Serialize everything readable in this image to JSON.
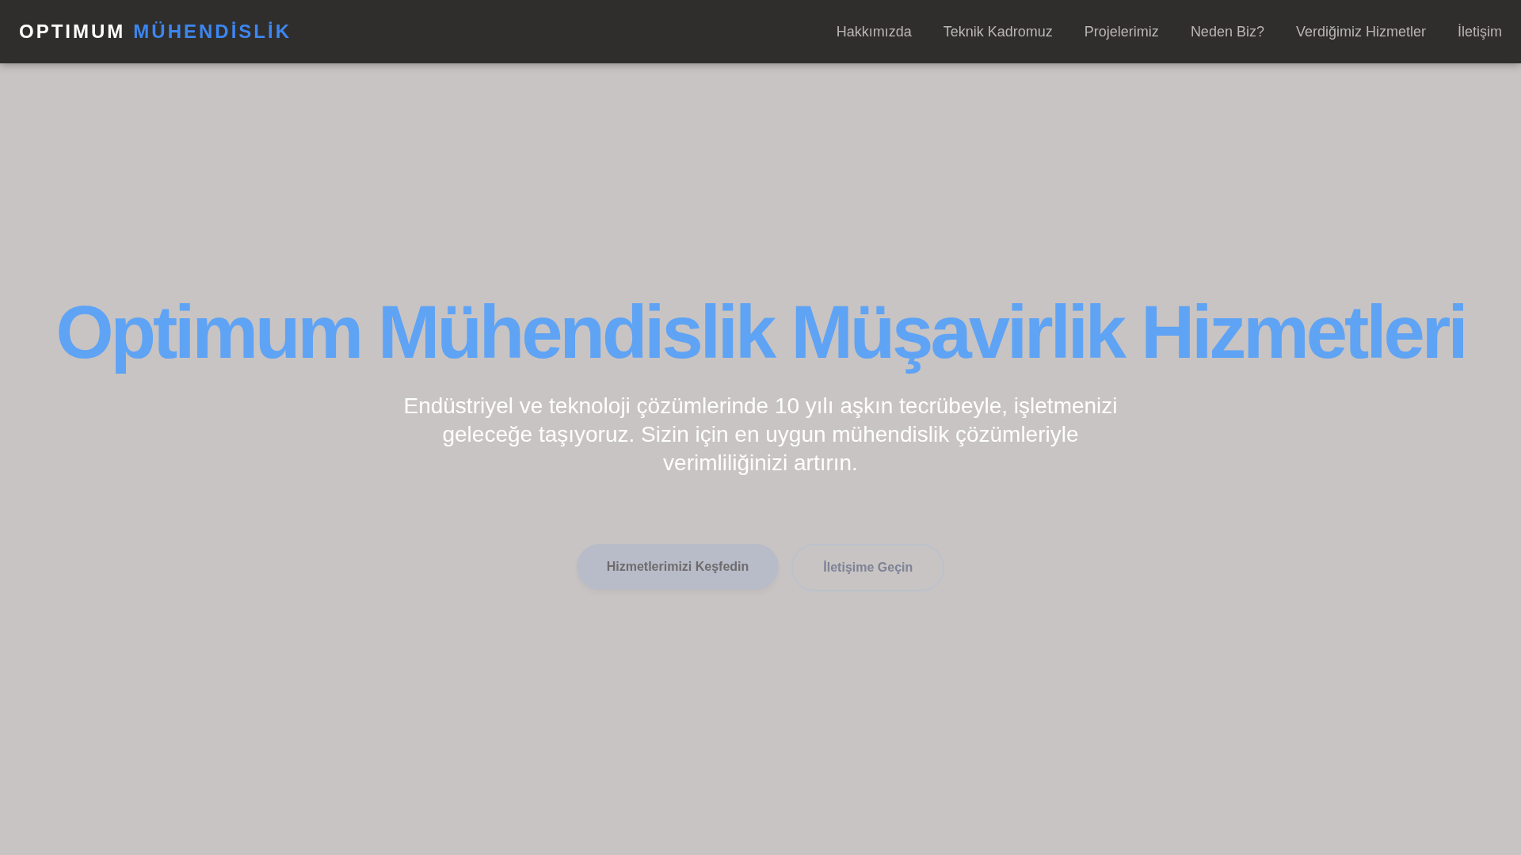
{
  "brand": {
    "first": "OPTIMUM",
    "second": "MÜHENDİSLİK"
  },
  "nav": [
    "Hakkımızda",
    "Teknik Kadromuz",
    "Projelerimiz",
    "Neden Biz?",
    "Verdiğimiz Hizmetler",
    "İletişim"
  ],
  "hero": {
    "title": "Optimum Mühendislik Müşavirlik Hizmetleri",
    "subtitle": "Endüstriyel ve teknoloji çözümlerinde 10 yılı aşkın tecrübeyle, işletmenizi geleceğe taşıyoruz. Sizin için en uygun mühendislik çözümleriyle verimliliğinizi artırın.",
    "buttons": [
      {
        "label": "Hizmetlerimizi Keşfedin",
        "kind": "primary"
      },
      {
        "label": "İletişime Geçin",
        "kind": "outline"
      }
    ]
  }
}
